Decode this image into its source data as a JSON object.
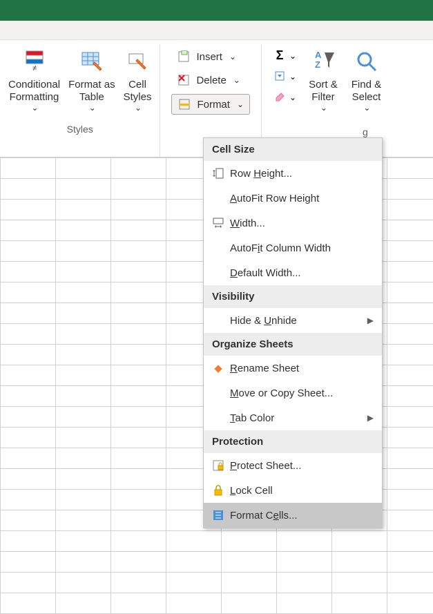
{
  "titlebar": {
    "username": ""
  },
  "ribbon": {
    "styles": {
      "conditional_formatting": "Conditional\nFormatting",
      "format_as_table": "Format as\nTable",
      "cell_styles": "Cell\nStyles",
      "group_label": "Styles"
    },
    "cells": {
      "insert": "Insert",
      "delete": "Delete",
      "format": "Format"
    },
    "editing": {
      "sort_filter": "Sort &\nFilter",
      "find_select": "Find &\nSelect",
      "group_label_partial": "g"
    }
  },
  "dropdown": {
    "sections": {
      "cell_size": "Cell Size",
      "visibility": "Visibility",
      "organize": "Organize Sheets",
      "protection": "Protection"
    },
    "items": {
      "row_height": "Row Height...",
      "autofit_row": "AutoFit Row Height",
      "width": "Width...",
      "autofit_col": "AutoFit Column Width",
      "default_width": "Default Width...",
      "hide_unhide": "Hide & Unhide",
      "rename_sheet": "Rename Sheet",
      "move_copy": "Move or Copy Sheet...",
      "tab_color": "Tab Color",
      "protect_sheet": "Protect Sheet...",
      "lock_cell": "Lock Cell",
      "format_cells": "Format Cells..."
    }
  }
}
